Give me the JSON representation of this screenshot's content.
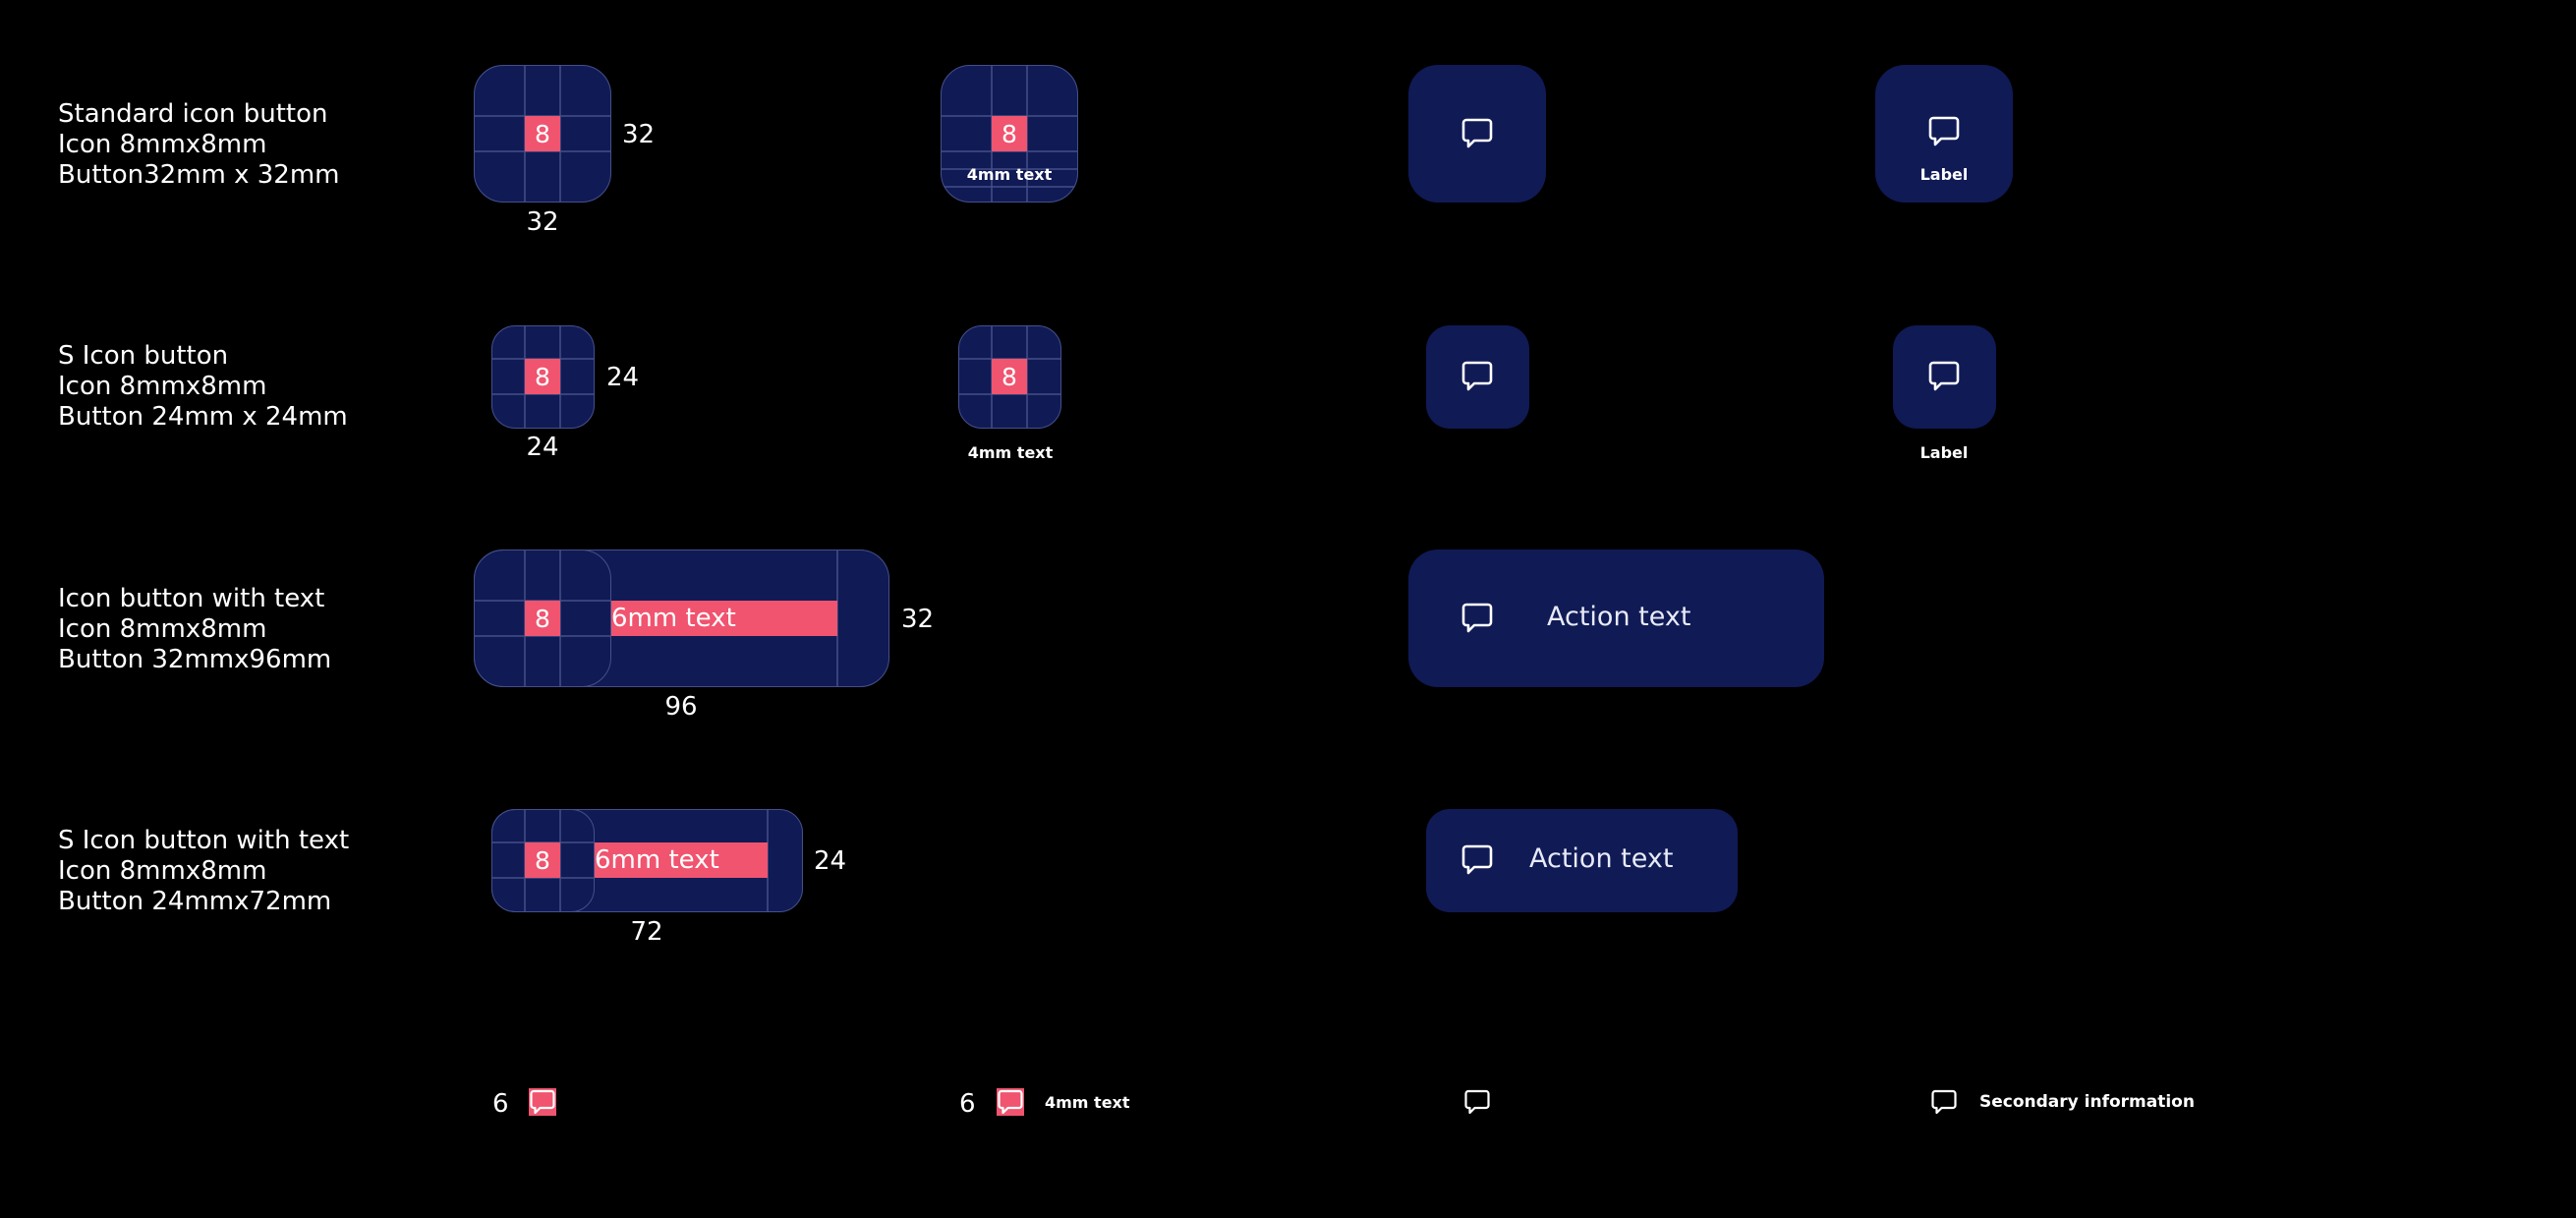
{
  "rows": [
    {
      "lines": [
        "Standard icon button",
        "Icon 8mmx8mm",
        "Button32mm x 32mm"
      ]
    },
    {
      "lines": [
        "S Icon button",
        "Icon 8mmx8mm",
        "Button 24mm x 24mm"
      ]
    },
    {
      "lines": [
        "Icon button with text",
        "Icon 8mmx8mm",
        "Button 32mmx96mm"
      ]
    },
    {
      "lines": [
        "S Icon button with text",
        "Icon 8mmx8mm",
        "Button 24mmx72mm"
      ]
    }
  ],
  "dims": {
    "std_w": "32",
    "std_h": "32",
    "s_w": "24",
    "s_h": "24",
    "wide_w": "96",
    "wide_h": "32",
    "swide_w": "72",
    "swide_h": "24",
    "inline_icon": "6",
    "inline_text_icon": "6"
  },
  "icon_size_label": "8",
  "text_4mm": "4mm text",
  "text_6mm": "6mm text",
  "label": "Label",
  "action_text": "Action text",
  "secondary_info": "Secondary information",
  "colors": {
    "background": "#000000",
    "button_fill": "#101a55",
    "guide_pink": "#f0546f",
    "grid_line": "#44508a",
    "icon_stroke": "#ffffff"
  },
  "icon_name": "chat-bubble-icon"
}
